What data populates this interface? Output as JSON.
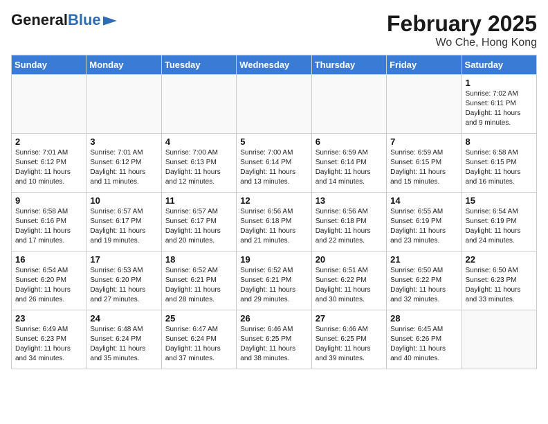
{
  "header": {
    "logo_general": "General",
    "logo_blue": "Blue",
    "month": "February 2025",
    "location": "Wo Che, Hong Kong"
  },
  "weekdays": [
    "Sunday",
    "Monday",
    "Tuesday",
    "Wednesday",
    "Thursday",
    "Friday",
    "Saturday"
  ],
  "weeks": [
    [
      {
        "day": "",
        "info": ""
      },
      {
        "day": "",
        "info": ""
      },
      {
        "day": "",
        "info": ""
      },
      {
        "day": "",
        "info": ""
      },
      {
        "day": "",
        "info": ""
      },
      {
        "day": "",
        "info": ""
      },
      {
        "day": "1",
        "info": "Sunrise: 7:02 AM\nSunset: 6:11 PM\nDaylight: 11 hours\nand 9 minutes."
      }
    ],
    [
      {
        "day": "2",
        "info": "Sunrise: 7:01 AM\nSunset: 6:12 PM\nDaylight: 11 hours\nand 10 minutes."
      },
      {
        "day": "3",
        "info": "Sunrise: 7:01 AM\nSunset: 6:12 PM\nDaylight: 11 hours\nand 11 minutes."
      },
      {
        "day": "4",
        "info": "Sunrise: 7:00 AM\nSunset: 6:13 PM\nDaylight: 11 hours\nand 12 minutes."
      },
      {
        "day": "5",
        "info": "Sunrise: 7:00 AM\nSunset: 6:14 PM\nDaylight: 11 hours\nand 13 minutes."
      },
      {
        "day": "6",
        "info": "Sunrise: 6:59 AM\nSunset: 6:14 PM\nDaylight: 11 hours\nand 14 minutes."
      },
      {
        "day": "7",
        "info": "Sunrise: 6:59 AM\nSunset: 6:15 PM\nDaylight: 11 hours\nand 15 minutes."
      },
      {
        "day": "8",
        "info": "Sunrise: 6:58 AM\nSunset: 6:15 PM\nDaylight: 11 hours\nand 16 minutes."
      }
    ],
    [
      {
        "day": "9",
        "info": "Sunrise: 6:58 AM\nSunset: 6:16 PM\nDaylight: 11 hours\nand 17 minutes."
      },
      {
        "day": "10",
        "info": "Sunrise: 6:57 AM\nSunset: 6:17 PM\nDaylight: 11 hours\nand 19 minutes."
      },
      {
        "day": "11",
        "info": "Sunrise: 6:57 AM\nSunset: 6:17 PM\nDaylight: 11 hours\nand 20 minutes."
      },
      {
        "day": "12",
        "info": "Sunrise: 6:56 AM\nSunset: 6:18 PM\nDaylight: 11 hours\nand 21 minutes."
      },
      {
        "day": "13",
        "info": "Sunrise: 6:56 AM\nSunset: 6:18 PM\nDaylight: 11 hours\nand 22 minutes."
      },
      {
        "day": "14",
        "info": "Sunrise: 6:55 AM\nSunset: 6:19 PM\nDaylight: 11 hours\nand 23 minutes."
      },
      {
        "day": "15",
        "info": "Sunrise: 6:54 AM\nSunset: 6:19 PM\nDaylight: 11 hours\nand 24 minutes."
      }
    ],
    [
      {
        "day": "16",
        "info": "Sunrise: 6:54 AM\nSunset: 6:20 PM\nDaylight: 11 hours\nand 26 minutes."
      },
      {
        "day": "17",
        "info": "Sunrise: 6:53 AM\nSunset: 6:20 PM\nDaylight: 11 hours\nand 27 minutes."
      },
      {
        "day": "18",
        "info": "Sunrise: 6:52 AM\nSunset: 6:21 PM\nDaylight: 11 hours\nand 28 minutes."
      },
      {
        "day": "19",
        "info": "Sunrise: 6:52 AM\nSunset: 6:21 PM\nDaylight: 11 hours\nand 29 minutes."
      },
      {
        "day": "20",
        "info": "Sunrise: 6:51 AM\nSunset: 6:22 PM\nDaylight: 11 hours\nand 30 minutes."
      },
      {
        "day": "21",
        "info": "Sunrise: 6:50 AM\nSunset: 6:22 PM\nDaylight: 11 hours\nand 32 minutes."
      },
      {
        "day": "22",
        "info": "Sunrise: 6:50 AM\nSunset: 6:23 PM\nDaylight: 11 hours\nand 33 minutes."
      }
    ],
    [
      {
        "day": "23",
        "info": "Sunrise: 6:49 AM\nSunset: 6:23 PM\nDaylight: 11 hours\nand 34 minutes."
      },
      {
        "day": "24",
        "info": "Sunrise: 6:48 AM\nSunset: 6:24 PM\nDaylight: 11 hours\nand 35 minutes."
      },
      {
        "day": "25",
        "info": "Sunrise: 6:47 AM\nSunset: 6:24 PM\nDaylight: 11 hours\nand 37 minutes."
      },
      {
        "day": "26",
        "info": "Sunrise: 6:46 AM\nSunset: 6:25 PM\nDaylight: 11 hours\nand 38 minutes."
      },
      {
        "day": "27",
        "info": "Sunrise: 6:46 AM\nSunset: 6:25 PM\nDaylight: 11 hours\nand 39 minutes."
      },
      {
        "day": "28",
        "info": "Sunrise: 6:45 AM\nSunset: 6:26 PM\nDaylight: 11 hours\nand 40 minutes."
      },
      {
        "day": "",
        "info": ""
      }
    ]
  ]
}
